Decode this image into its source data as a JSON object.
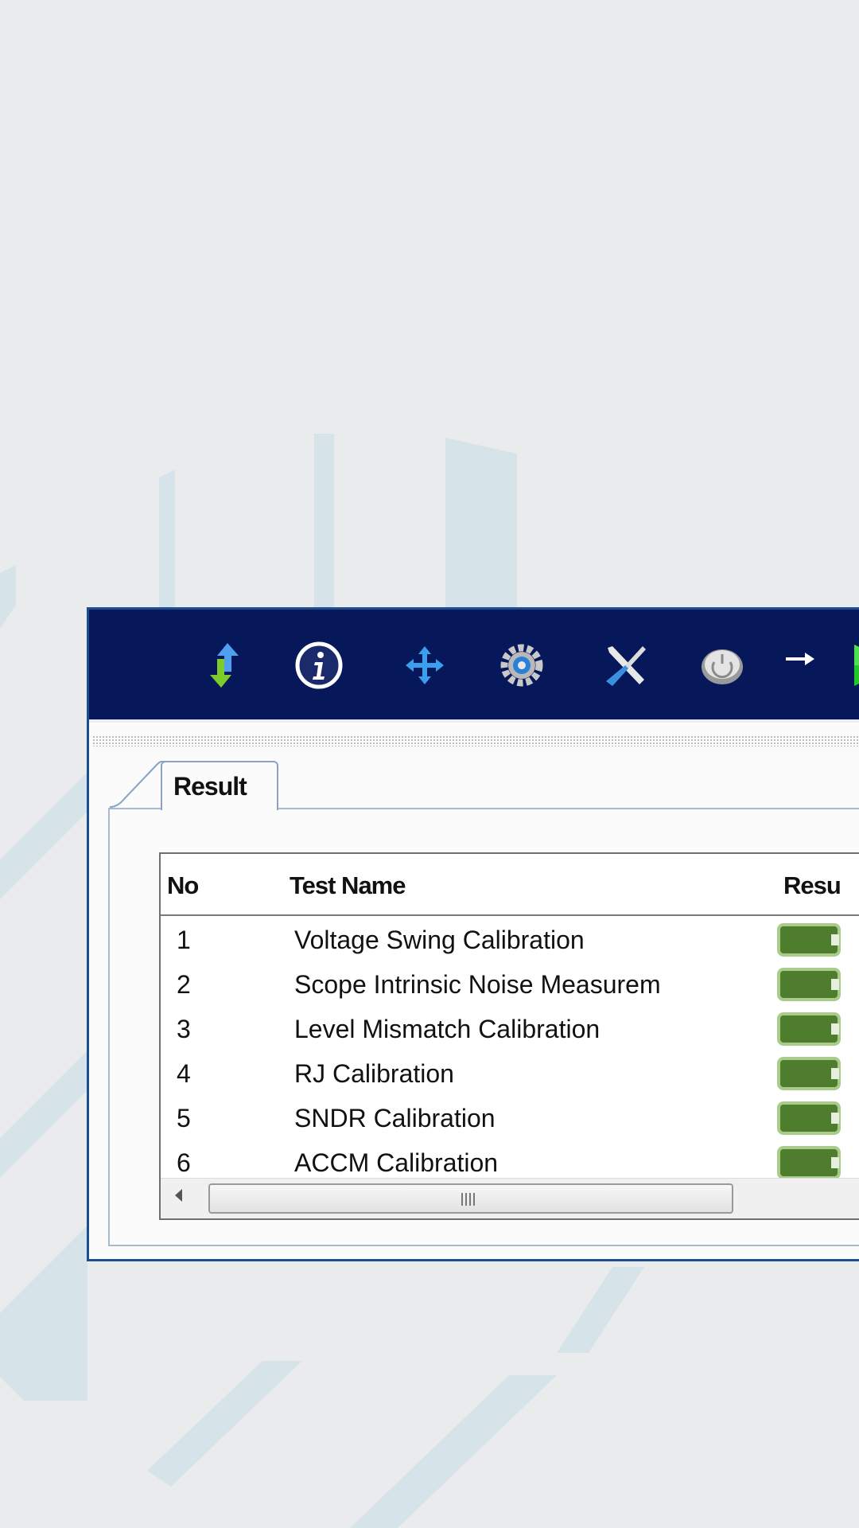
{
  "toolbar": {
    "icons": [
      "swap-arrows-icon",
      "info-icon",
      "move-cross-icon",
      "gear-icon",
      "tools-icon",
      "power-icon",
      "arrow-right-icon",
      "play-icon",
      "arrow-right-icon"
    ]
  },
  "tabs": [
    {
      "label": "Result"
    }
  ],
  "grid": {
    "columns": {
      "no": "No",
      "test_name": "Test Name",
      "result": "Resu"
    },
    "rows": [
      {
        "no": "1",
        "name": "Voltage Swing Calibration",
        "result": "pass"
      },
      {
        "no": "2",
        "name": "Scope Intrinsic Noise Measurem",
        "result": "pass"
      },
      {
        "no": "3",
        "name": "Level Mismatch Calibration",
        "result": "pass"
      },
      {
        "no": "4",
        "name": "RJ Calibration",
        "result": "pass"
      },
      {
        "no": "5",
        "name": "SNDR Calibration",
        "result": "pass"
      },
      {
        "no": "6",
        "name": "ACCM Calibration",
        "result": "pass"
      }
    ],
    "scrollbar_grip": "III"
  },
  "colors": {
    "toolbar": "#06175a",
    "pass": "#4f7d2e"
  }
}
